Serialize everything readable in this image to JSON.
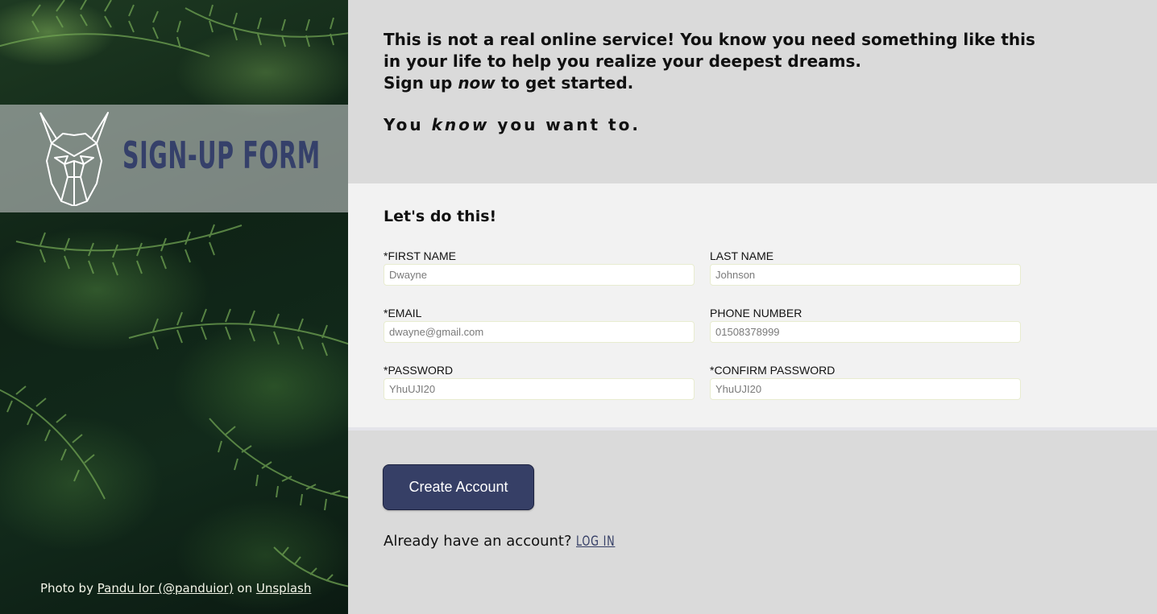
{
  "brand": {
    "title": "SIGN-UP FORM"
  },
  "credit": {
    "prefix": "Photo by",
    "author": "Pandu Ior (@panduior)",
    "middle": "on",
    "site": "Unsplash"
  },
  "intro": {
    "line1": "This is not a real online service! You know you need something like this in your life to help you realize your deepest dreams.",
    "line2_before": "Sign up",
    "line2_em": "now",
    "line2_after": "to get started.",
    "tag_before": "You",
    "tag_em": "know",
    "tag_after": "you want to."
  },
  "form": {
    "heading": "Let's do this!",
    "fields": [
      {
        "label": "*FIRST NAME",
        "placeholder": "Dwayne"
      },
      {
        "label": "LAST NAME",
        "placeholder": "Johnson"
      },
      {
        "label": "*EMAIL",
        "placeholder": "dwayne@gmail.com"
      },
      {
        "label": "PHONE NUMBER",
        "placeholder": "01508378999"
      },
      {
        "label": "*PASSWORD",
        "placeholder": "YhuUJI20"
      },
      {
        "label": "*CONFIRM PASSWORD",
        "placeholder": "YhuUJI20"
      }
    ]
  },
  "actions": {
    "create_label": "Create Account",
    "login_prompt": "Already have an account?",
    "login_label": "LOG IN"
  },
  "colors": {
    "accent": "#363f66",
    "background": "#dadada",
    "panel": "#f2f2f2"
  }
}
